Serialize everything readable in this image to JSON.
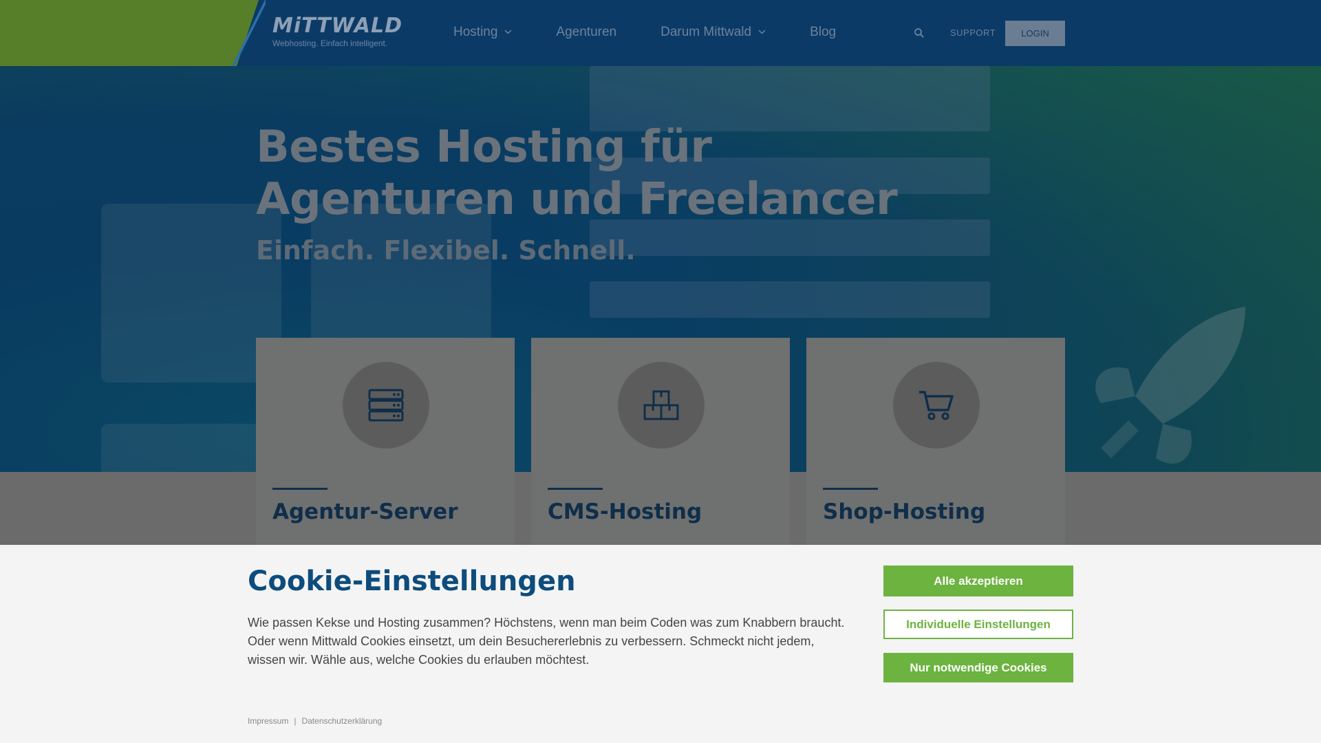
{
  "header": {
    "logo_word": "MiTTWALD",
    "logo_tagline": "Webhosting. Einfach intelligent.",
    "nav": [
      {
        "label": "Hosting",
        "has_dropdown": true
      },
      {
        "label": "Agenturen",
        "has_dropdown": false
      },
      {
        "label": "Darum Mittwald",
        "has_dropdown": true
      },
      {
        "label": "Blog",
        "has_dropdown": false
      }
    ],
    "support_label": "SUPPORT",
    "login_label": "LOGIN"
  },
  "hero": {
    "title_line1": "Bestes Hosting für",
    "title_line2": "Agenturen und Freelancer",
    "subtitle": "Einfach. Flexibel. Schnell."
  },
  "cards": [
    {
      "title": "Agentur-Server",
      "icon": "server-icon"
    },
    {
      "title": "CMS-Hosting",
      "icon": "boxes-icon"
    },
    {
      "title": "Shop-Hosting",
      "icon": "shopping-cart-icon"
    }
  ],
  "cookie": {
    "title": "Cookie-Einstellungen",
    "text": "Wie passen Kekse und Hosting zusammen? Höchstens, wenn man beim Coden was zum Knabbern braucht. Oder wenn Mittwald Cookies einsetzt, um dein Besuchererlebnis zu verbessern. Schmeckt nicht jedem, wissen wir. Wähle aus, welche Cookies du erlauben möchtest.",
    "accept_all": "Alle akzeptieren",
    "individual": "Individuelle Einstellungen",
    "necessary_only": "Nur notwendige Cookies",
    "footer": {
      "impressum": "Impressum",
      "separator": "|",
      "privacy": "Datenschutzerklärung"
    }
  },
  "colors": {
    "header_bg": "#0b3a66",
    "header_green": "#577f2a",
    "accent_green": "#6cb33f",
    "cookie_title": "#0d4c7c"
  }
}
